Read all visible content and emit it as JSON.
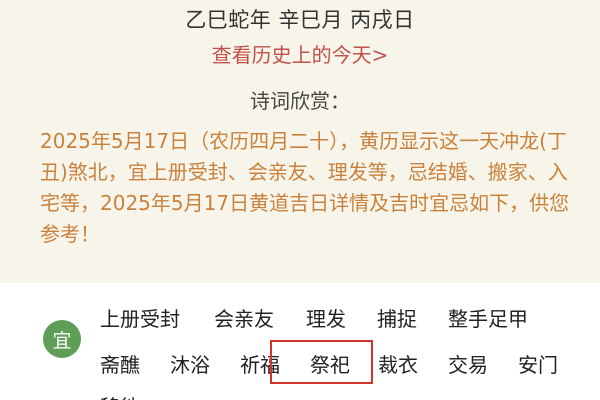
{
  "header": {
    "ganzhi": "乙巳蛇年  辛巳月  丙戌日",
    "history_link": "查看历史上的今天>",
    "poem_label": "诗词欣赏："
  },
  "description": "2025年5月17日（农历四月二十），黄历显示这一天冲龙(丁丑)煞北，宜上册受封、会亲友、理发等，忌结婚、搬家、入宅等，2025年5月17日黄道吉日详情及吉时宜忌如下，供您参考！",
  "yi": {
    "badge": "宜",
    "items": [
      "上册受封",
      "会亲友",
      "理发",
      "捕捉",
      "整手足甲",
      "斋醮",
      "沐浴",
      "祈福",
      "祭祀",
      "裁衣",
      "交易",
      "安门",
      "移徙"
    ]
  },
  "colors": {
    "card_bg": "#f7f4ea",
    "link": "#c0524a",
    "description_text": "#c9823d",
    "badge_green": "#5e9e57",
    "highlight_border": "#d8312d"
  }
}
